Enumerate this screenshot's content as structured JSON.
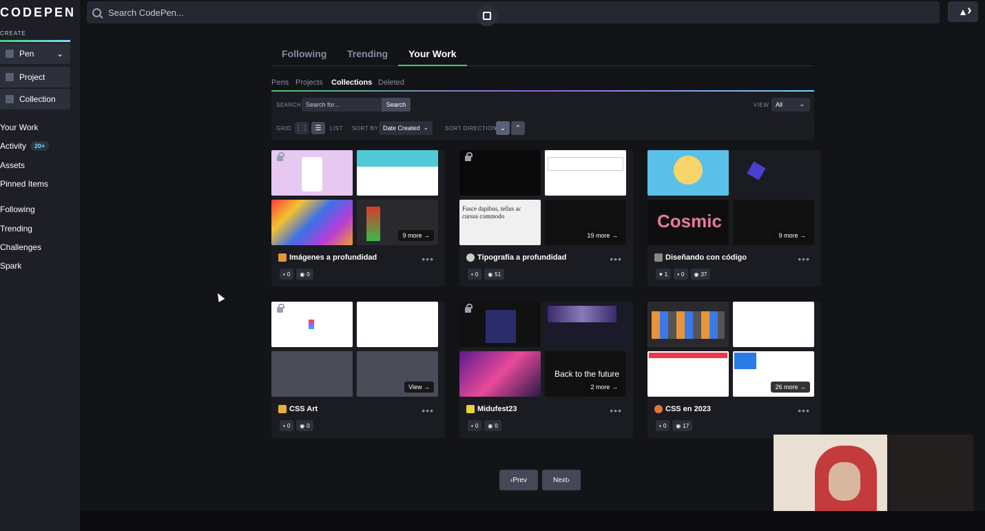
{
  "logo": "CODEPEN",
  "sidebar": {
    "create_label": "CREATE",
    "create_items": [
      {
        "label": "Pen"
      },
      {
        "label": "Project"
      },
      {
        "label": "Collection"
      }
    ],
    "nav": [
      {
        "label": "Your Work"
      },
      {
        "label": "Activity",
        "badge": "20+"
      },
      {
        "label": "Assets"
      },
      {
        "label": "Pinned Items"
      },
      {
        "label": "Following"
      },
      {
        "label": "Trending"
      },
      {
        "label": "Challenges"
      },
      {
        "label": "Spark"
      }
    ]
  },
  "topbar": {
    "search_placeholder": "Search CodePen..."
  },
  "tabs": [
    "Following",
    "Trending",
    "Your Work"
  ],
  "active_tab": "Your Work",
  "subtabs": [
    "Pens",
    "Projects",
    "Collections",
    "Deleted"
  ],
  "active_subtab": "Collections",
  "filters": {
    "search_label": "SEARCH",
    "search_placeholder": "Search for...",
    "search_button": "Search",
    "view_label": "VIEW",
    "view_value": "All",
    "grid_label": "GRID",
    "list_label": "LIST",
    "sort_label": "SORT BY",
    "sort_value": "Date Created",
    "direction_label": "SORT DIRECTION"
  },
  "collections": [
    {
      "title": "Imágenes a profundidad",
      "more": "9 more",
      "comments": "0",
      "views": "0"
    },
    {
      "title": "Tipografía a profundidad",
      "more": "19 more",
      "comments": "0",
      "views": "51"
    },
    {
      "title": "Diseñando con código",
      "more": "9 more",
      "likes": "1",
      "comments": "0",
      "views": "37"
    },
    {
      "title": "CSS Art",
      "more": "View",
      "comments": "0",
      "views": "0"
    },
    {
      "title": "Midufest23",
      "more": "2 more",
      "comments": "0",
      "views": "0"
    },
    {
      "title": "CSS en 2023",
      "more": "26 more",
      "comments": "0",
      "views": "17"
    }
  ],
  "thumb_texts": {
    "serif_text": "Fusce dapibus, tellus ac cursus commodo",
    "cosmic": "Cosmic",
    "future": "Back to the future"
  },
  "pagination": {
    "prev": "Prev",
    "next": "Next"
  },
  "colors": {
    "accent_green": "#47cf73",
    "accent_blue": "#76daff",
    "bg": "#131417"
  }
}
